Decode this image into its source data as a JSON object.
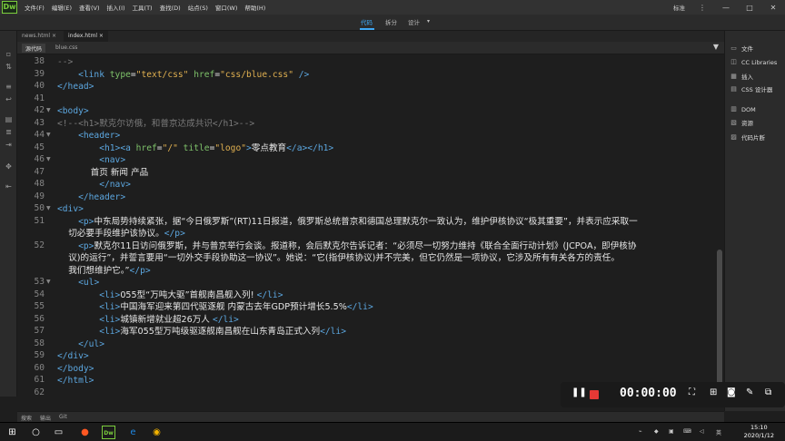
{
  "app": {
    "logo": "Dw"
  },
  "menu": [
    "文件(F)",
    "编辑(E)",
    "查看(V)",
    "插入(I)",
    "工具(T)",
    "查找(D)",
    "站点(S)",
    "窗口(W)",
    "帮助(H)"
  ],
  "workspace": "标准",
  "window_controls": [
    "⋮",
    "—",
    "□",
    "✕"
  ],
  "view_tabs": {
    "code": "代码",
    "split": "拆分",
    "design": "设计"
  },
  "doc_tabs": [
    "news.html",
    "index.html"
  ],
  "sub_tabs": {
    "source": "源代码",
    "css": "blue.css"
  },
  "panels": [
    {
      "label": "文件",
      "icon": "folder-icon"
    },
    {
      "label": "CC Libraries",
      "icon": "cc-libraries-icon"
    },
    {
      "label": "插入",
      "icon": "insert-icon"
    },
    {
      "label": "CSS 设计器",
      "icon": "css-designer-icon"
    },
    {
      "label": "DOM",
      "icon": "dom-icon"
    },
    {
      "label": "资源",
      "icon": "assets-icon"
    },
    {
      "label": "代码片断",
      "icon": "snippets-icon"
    }
  ],
  "code_lines": [
    {
      "n": "38",
      "fold": "",
      "text": "-->"
    },
    {
      "n": "39",
      "fold": "",
      "text": "    <link type=\"text/css\" href=\"css/blue.css\" />"
    },
    {
      "n": "40",
      "fold": "",
      "text": "</head>"
    },
    {
      "n": "41",
      "fold": "",
      "text": ""
    },
    {
      "n": "42",
      "fold": "▼",
      "text": "<body>"
    },
    {
      "n": "43",
      "fold": "",
      "text": "<!--<h1>默克尔访俄，和普京达成共识</h1>-->"
    },
    {
      "n": "44",
      "fold": "▼",
      "text": "    <header>"
    },
    {
      "n": "45",
      "fold": "",
      "text": "        <h1><a href=\"/\" title=\"logo\">零点教育</a></h1>"
    },
    {
      "n": "46",
      "fold": "▼",
      "text": "        <nav>"
    },
    {
      "n": "47",
      "fold": "",
      "text": "            首页 新闻 产品"
    },
    {
      "n": "48",
      "fold": "",
      "text": "        </nav>"
    },
    {
      "n": "49",
      "fold": "",
      "text": "    </header>"
    },
    {
      "n": "50",
      "fold": "▼",
      "text": "<div>"
    },
    {
      "n": "51",
      "fold": "",
      "text": "    <p>中东局势持续紧张，据“今日俄罗斯”(RT)11日报道，俄罗斯总统普京和德国总理默克尔一致认为，维护伊核协议“极其重要”，并表示应采取一"
    },
    {
      "n": "",
      "fold": "",
      "text": "    切必要手段维护该协议。</p>"
    },
    {
      "n": "52",
      "fold": "",
      "text": "    <p>默克尔11日访问俄罗斯，并与普京举行会谈。报道称，会后默克尔告诉记者：“必须尽一切努力维持《联合全面行动计划》(JCPOA，即伊核协"
    },
    {
      "n": "",
      "fold": "",
      "text": "    议)的运行”，并誓言要用“一切外交手段协助这一协议”。她说：“它(指伊核协议)并不完美，但它仍然是一项协议，它涉及所有有关各方的责任。"
    },
    {
      "n": "",
      "fold": "",
      "text": "    我们想维护它。”</p>"
    },
    {
      "n": "53",
      "fold": "▼",
      "text": "    <ul>"
    },
    {
      "n": "54",
      "fold": "",
      "text": "        <li>055型“万吨大驱”首舰南昌舰入列! </li>"
    },
    {
      "n": "55",
      "fold": "",
      "text": "        <li>中国海军迎来第四代驱逐舰 内蒙古去年GDP预计增长5.5%</li>"
    },
    {
      "n": "56",
      "fold": "",
      "text": "        <li>城镇新增就业超26万人 </li>"
    },
    {
      "n": "57",
      "fold": "",
      "text": "        <li>海军055型万吨级驱逐舰南昌舰在山东青岛正式入列</li>"
    },
    {
      "n": "58",
      "fold": "",
      "text": "    </ul>"
    },
    {
      "n": "59",
      "fold": "",
      "text": "</div>"
    },
    {
      "n": "60",
      "fold": "",
      "text": "</body>"
    },
    {
      "n": "61",
      "fold": "",
      "text": "</html>"
    },
    {
      "n": "62",
      "fold": "",
      "text": ""
    }
  ],
  "bottom_tabs": [
    "搜索",
    "输出",
    "Git"
  ],
  "recorder": {
    "timer": "00:00:00"
  },
  "clock": {
    "time": "15:10",
    "date": "2020/1/12"
  },
  "colors": {
    "tag": "#5ca7e0",
    "attr": "#7ec26a",
    "value": "#e0b050",
    "comment": "#7a7a7a",
    "accent": "#3fa9f5",
    "record": "#e53935"
  }
}
